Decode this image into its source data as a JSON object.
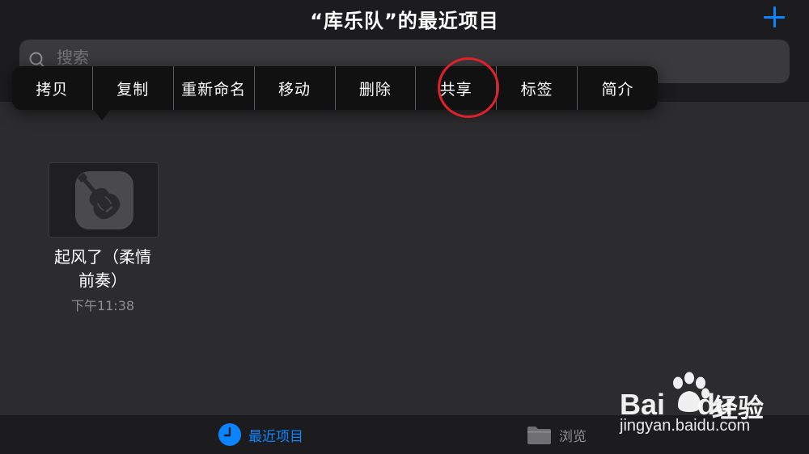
{
  "header": {
    "title": "“库乐队”的最近项目"
  },
  "search": {
    "placeholder": "搜索"
  },
  "context_menu": {
    "items": [
      "拷贝",
      "复制",
      "重新命名",
      "移动",
      "删除",
      "共享",
      "标签",
      "简介"
    ]
  },
  "file": {
    "name_line1": "起风了（柔情",
    "name_line2": "前奏）",
    "time": "下午11:38"
  },
  "tabbar": {
    "recent_label": "最近项目",
    "browse_label": "浏览"
  },
  "watermark": {
    "brand": "Bai",
    "brand_suffix": "du",
    "cn": "经验",
    "url": "jingyan.baidu.com"
  },
  "colors": {
    "accent": "#0a84ff",
    "highlight": "#e0202a",
    "background": "#2c2c2e"
  }
}
